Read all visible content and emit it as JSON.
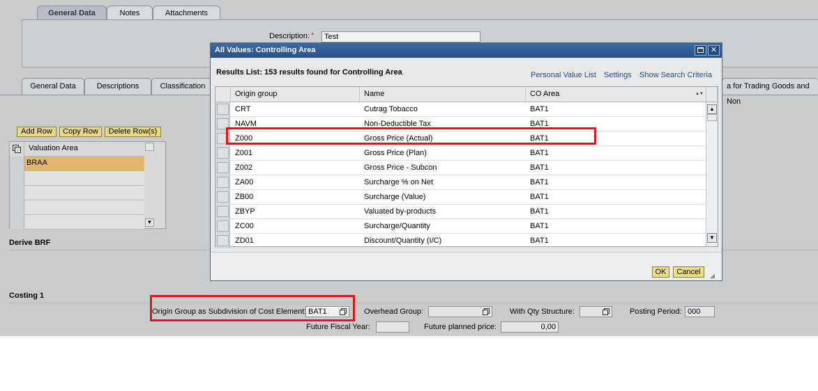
{
  "top_tabs": [
    "General Data",
    "Notes",
    "Attachments"
  ],
  "header": {
    "description_label": "Description:",
    "required_mark": "*",
    "description_value": "Test"
  },
  "sub_tabs": [
    "General Data",
    "Descriptions",
    "Classification"
  ],
  "sub_tab_right_fragment": "a for Trading Goods and Non",
  "valuation": {
    "buttons": [
      "Add Row",
      "Copy Row",
      "Delete Row(s)"
    ],
    "column_header": "Valuation Area",
    "rows": [
      "BRAA",
      "",
      "",
      "",
      ""
    ]
  },
  "sections": {
    "derive": "Derive BRF",
    "costing": "Costing 1"
  },
  "costing": {
    "origin_label": "Origin Group as Subdivision of Cost Element:",
    "origin_value": "BAT1",
    "overhead_label": "Overhead Group:",
    "overhead_value": "",
    "qty_label": "With Qty Structure:",
    "qty_value": "",
    "posting_label": "Posting Period:",
    "posting_value": "000",
    "future_fy_label": "Future Fiscal Year:",
    "future_fy_value": "",
    "future_price_label": "Future planned price:",
    "future_price_value": "0,00"
  },
  "dialog": {
    "title": "All Values: Controlling Area",
    "results_text": "Results List: 153 results found for Controlling Area",
    "links": [
      "Personal Value List",
      "Settings",
      "Show Search Criteria"
    ],
    "columns": [
      "Origin group",
      "Name",
      "CO Area"
    ],
    "rows": [
      {
        "origin": "CRT",
        "name": "Cutrag Tobacco",
        "area": "BAT1"
      },
      {
        "origin": "NAVM",
        "name": "Non-Deductible Tax",
        "area": "BAT1"
      },
      {
        "origin": "Z000",
        "name": "Gross Price (Actual)",
        "area": "BAT1"
      },
      {
        "origin": "Z001",
        "name": "Gross Price (Plan)",
        "area": "BAT1"
      },
      {
        "origin": "Z002",
        "name": "Gross Price - Subcon",
        "area": "BAT1"
      },
      {
        "origin": "ZA00",
        "name": "Surcharge % on Net",
        "area": "BAT1"
      },
      {
        "origin": "ZB00",
        "name": "Surcharge (Value)",
        "area": "BAT1"
      },
      {
        "origin": "ZBYP",
        "name": "Valuated by-products",
        "area": "BAT1"
      },
      {
        "origin": "ZC00",
        "name": "Surcharge/Quantity",
        "area": "BAT1"
      },
      {
        "origin": "ZD01",
        "name": "Discount/Quantity (I/C)",
        "area": "BAT1"
      }
    ],
    "ok_label": "OK",
    "cancel_label": "Cancel",
    "sort_indicator": "▲▼"
  },
  "colors": {
    "highlight_red": "#e0141e",
    "title_blue": "#2f5b95",
    "button_yellow": "#f1df87",
    "selected_row": "#e3b86e"
  }
}
